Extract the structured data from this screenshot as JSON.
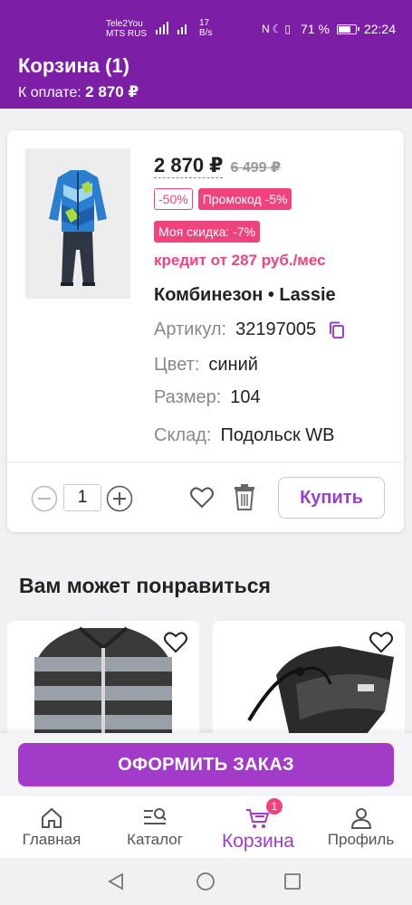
{
  "status_bar": {
    "carrier_1": "Tele2You",
    "carrier_2": "MTS RUS",
    "speed_value": "17",
    "speed_unit": "B/s",
    "battery": "71 %",
    "time": "22:24"
  },
  "header": {
    "title": "Корзина (1)",
    "total_label": "К оплате:",
    "total_value": "2 870 ₽"
  },
  "cart_item": {
    "price": "2 870 ₽",
    "old_price": "6 499 ₽",
    "discount_badge": "-50%",
    "promo_badge": "Промокод -5%",
    "my_discount_badge": "Моя скидка: -7%",
    "credit_text": "кредит от 287 руб./мес",
    "name": "Комбинезон • Lassie",
    "attributes": [
      {
        "key": "Артикул:",
        "value": "32197005"
      },
      {
        "key": "Цвет:",
        "value": "синий"
      },
      {
        "key": "Размер:",
        "value": "104"
      },
      {
        "key": "Склад:",
        "value": "Подольск WB"
      }
    ],
    "quantity": "1",
    "buy_label": "Купить"
  },
  "recommendations": {
    "title": "Вам может понравиться"
  },
  "checkout": {
    "label": "ОФОРМИТЬ ЗАКАЗ"
  },
  "bottom_nav": {
    "items": [
      {
        "label": "Главная",
        "icon": "home-icon"
      },
      {
        "label": "Каталог",
        "icon": "catalog-search-icon"
      },
      {
        "label": "Корзина",
        "icon": "cart-icon"
      },
      {
        "label": "Профиль",
        "icon": "profile-icon"
      }
    ],
    "active_index": 2,
    "cart_badge": "1"
  },
  "colors": {
    "brand_purple": "#7c1fa6",
    "button_purple": "#a23bc7",
    "accent_pink": "#f0437d"
  }
}
